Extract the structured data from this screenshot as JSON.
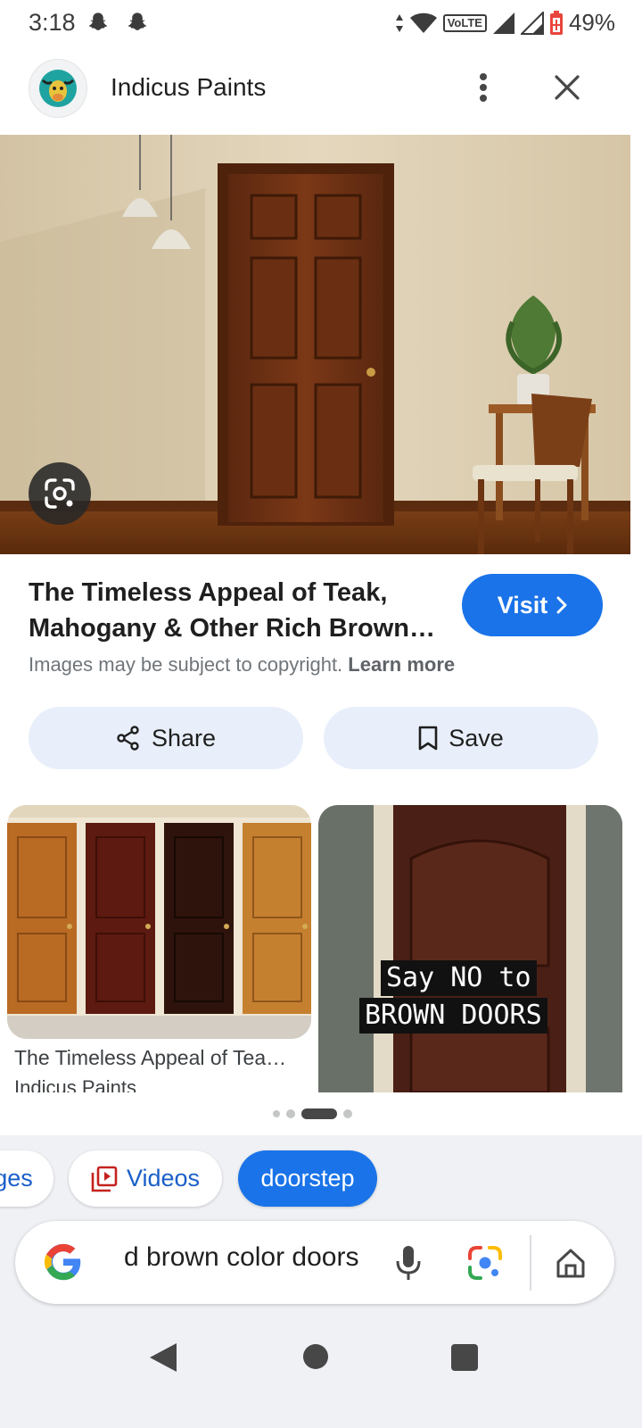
{
  "status_bar": {
    "time": "3:18",
    "battery": "49%",
    "network_label": "VoLTE",
    "icons": [
      "snapchat-icon",
      "snapchat-icon",
      "data-arrows-icon",
      "wifi-icon",
      "signal-icon",
      "signal-icon",
      "battery-saver-icon"
    ]
  },
  "header": {
    "site_name": "Indicus Paints",
    "icons": [
      "site-logo",
      "more-vert-icon",
      "close-icon"
    ]
  },
  "result": {
    "title": "The Timeless Appeal of Teak, Mahogany & Other Rich Brown…",
    "visit_label": "Visit",
    "copyright_text": "Images may be subject to copyright.",
    "learn_more": "Learn more",
    "share_label": "Share",
    "save_label": "Save"
  },
  "related": [
    {
      "title": "The Timeless Appeal of Tea…",
      "source": "Indicus Paints"
    },
    {
      "overlay_lines": [
        "Say NO to",
        "BROWN DOORS"
      ]
    }
  ],
  "pager": {
    "count": 4,
    "active_index": 2
  },
  "chips": [
    "ges",
    "Videos",
    "doorstep"
  ],
  "search": {
    "query": "d brown color doors"
  },
  "colors": {
    "accent": "#1a73e8",
    "chip_text": "#1a5fc8",
    "tonal_button": "#e8effa",
    "panel_bg": "#eff1f5"
  }
}
